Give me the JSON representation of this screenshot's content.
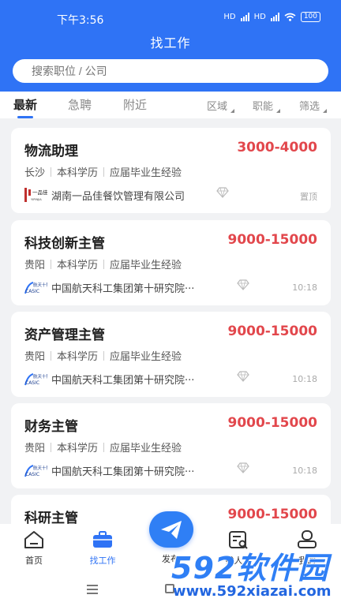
{
  "status": {
    "time": "下午3:56",
    "battery": "100",
    "hd": "HD"
  },
  "header": {
    "title": "找工作"
  },
  "search": {
    "placeholder": "搜索职位 / 公司"
  },
  "tabs": [
    "最新",
    "急聘",
    "附近"
  ],
  "filters": [
    "区域",
    "职能",
    "筛选"
  ],
  "jobs": [
    {
      "title": "物流助理",
      "salary": "3000-4000",
      "city": "长沙",
      "education": "本科学历",
      "experience": "应届毕业生经验",
      "company": "湖南一品佳餐饮管理有限公司",
      "meta": "置顶",
      "logo_text": "一品佳",
      "logo_sub": "YIPINJIA"
    },
    {
      "title": "科技创新主管",
      "salary": "9000-15000",
      "city": "贵阳",
      "education": "本科学历",
      "experience": "应届毕业生经验",
      "company": "中国航天科工集团第十研究院···",
      "meta": "10:18",
      "logo_text": "航天十院"
    },
    {
      "title": "资产管理主管",
      "salary": "9000-15000",
      "city": "贵阳",
      "education": "本科学历",
      "experience": "应届毕业生经验",
      "company": "中国航天科工集团第十研究院···",
      "meta": "10:18",
      "logo_text": "航天十院"
    },
    {
      "title": "财务主管",
      "salary": "9000-15000",
      "city": "贵阳",
      "education": "本科学历",
      "experience": "应届毕业生经验",
      "company": "中国航天科工集团第十研究院···",
      "meta": "10:18",
      "logo_text": "航天十院"
    },
    {
      "title": "科研主管",
      "salary": "9000-15000"
    }
  ],
  "tabbar": [
    "首页",
    "找工作",
    "发布",
    "找人才",
    "我的"
  ],
  "watermark": {
    "brand": "592软件园",
    "url": "www.592xiazai.com"
  },
  "colors": {
    "primary": "#2f73f5",
    "salary": "#e2474c",
    "background": "#f1f2f4"
  },
  "icons": [
    "home-icon",
    "briefcase-icon",
    "paper-plane-icon",
    "resume-search-icon",
    "user-icon",
    "diamond-icon"
  ]
}
